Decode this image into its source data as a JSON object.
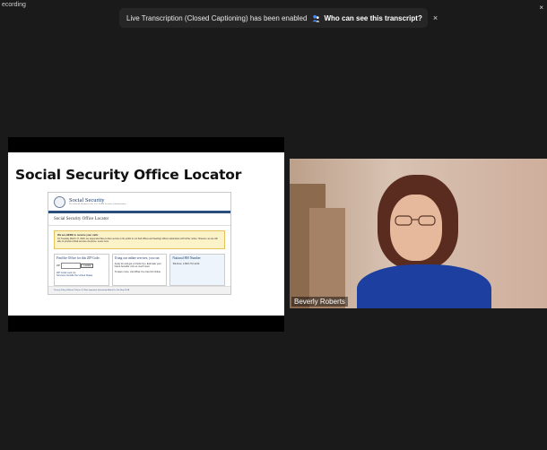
{
  "window": {
    "recording_label": "ecording",
    "close_glyph": "×"
  },
  "banner": {
    "message": "Live Transcription (Closed Captioning) has been enabled",
    "who_label": "Who can see this transcript?",
    "dismiss_glyph": "×"
  },
  "slide": {
    "title": "Social Security Office Locator",
    "webpage": {
      "org_name": "Social Security",
      "org_tagline": "The Official Website of the U.S. Social Security Administration",
      "page_title": "Social Security Office Locator",
      "alert_heading": "We are HERE to receive your calls",
      "alert_text": "On Tuesday, March 17, 2020, we suspended face-to-face service to the public in our field offices and hearings offices nationwide until further notice. However, we are still able to provide critical services via phone. Learn more.",
      "col1_heading": "Find the Office for this ZIP Code.",
      "col1_zip_label": "ZIP",
      "col1_button": "Locate",
      "col1_links": "ZIP Code Look Up\nServices Outside the United States",
      "col2_heading": "Using our online services, you can",
      "col2_items": "Apply for and get a Check Up • Estimate your future benefits • Do so much more",
      "col2_footer": "To learn more, visit What You Can Do Online.",
      "col3_heading": "National 800 Number",
      "col3_text": "Toll-Free: 1-800-772-1213",
      "footer_links": "Privacy Policy   Website Policies & Other Important Information   About Us   Site Map   FOIA"
    }
  },
  "video": {
    "participant_name": "Beverly Roberts"
  },
  "colors": {
    "background": "#1a1a1a",
    "banner": "#262626",
    "ssa_blue": "#1b3a6b",
    "alert_yellow": "#fcf2c7"
  }
}
